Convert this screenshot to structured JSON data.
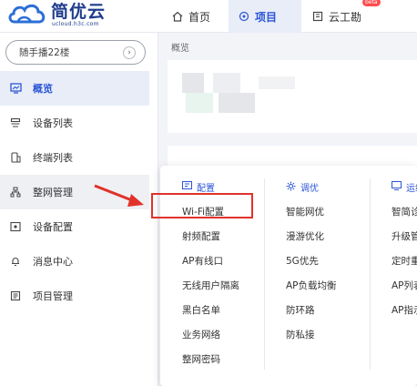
{
  "header": {
    "logo_text": "简优云",
    "logo_sub": "ucloud.h3c.com",
    "nav": [
      {
        "label": "首页",
        "icon": "home-icon"
      },
      {
        "label": "项目",
        "icon": "project-icon"
      },
      {
        "label": "云工勘",
        "icon": "survey-icon"
      }
    ],
    "beta_label": "beta"
  },
  "sidebar": {
    "project_selector": "随手播22楼",
    "items": [
      {
        "label": "概览",
        "icon": "overview-icon"
      },
      {
        "label": "设备列表",
        "icon": "device-list-icon"
      },
      {
        "label": "终端列表",
        "icon": "terminal-list-icon"
      },
      {
        "label": "整网管理",
        "icon": "network-manage-icon"
      },
      {
        "label": "设备配置",
        "icon": "device-config-icon"
      },
      {
        "label": "消息中心",
        "icon": "bell-icon"
      },
      {
        "label": "项目管理",
        "icon": "project-manage-icon"
      }
    ]
  },
  "main": {
    "section_label": "概览"
  },
  "dropdown": {
    "columns": [
      {
        "title": "配置",
        "icon": "config-icon",
        "items": [
          "Wi-Fi配置",
          "射频配置",
          "AP有线口",
          "无线用户隔离",
          "黑白名单",
          "业务网络",
          "整网密码"
        ]
      },
      {
        "title": "调优",
        "icon": "tune-icon",
        "items": [
          "智能网优",
          "漫游优化",
          "5G优先",
          "AP负载均衡",
          "防环路",
          "防私接"
        ]
      },
      {
        "title": "运维",
        "icon": "ops-icon",
        "items": [
          "智简诊",
          "升级管",
          "定时重",
          "AP列表",
          "AP指示"
        ]
      }
    ]
  },
  "colors": {
    "accent": "#2b55d6",
    "highlight": "#e0322b"
  }
}
